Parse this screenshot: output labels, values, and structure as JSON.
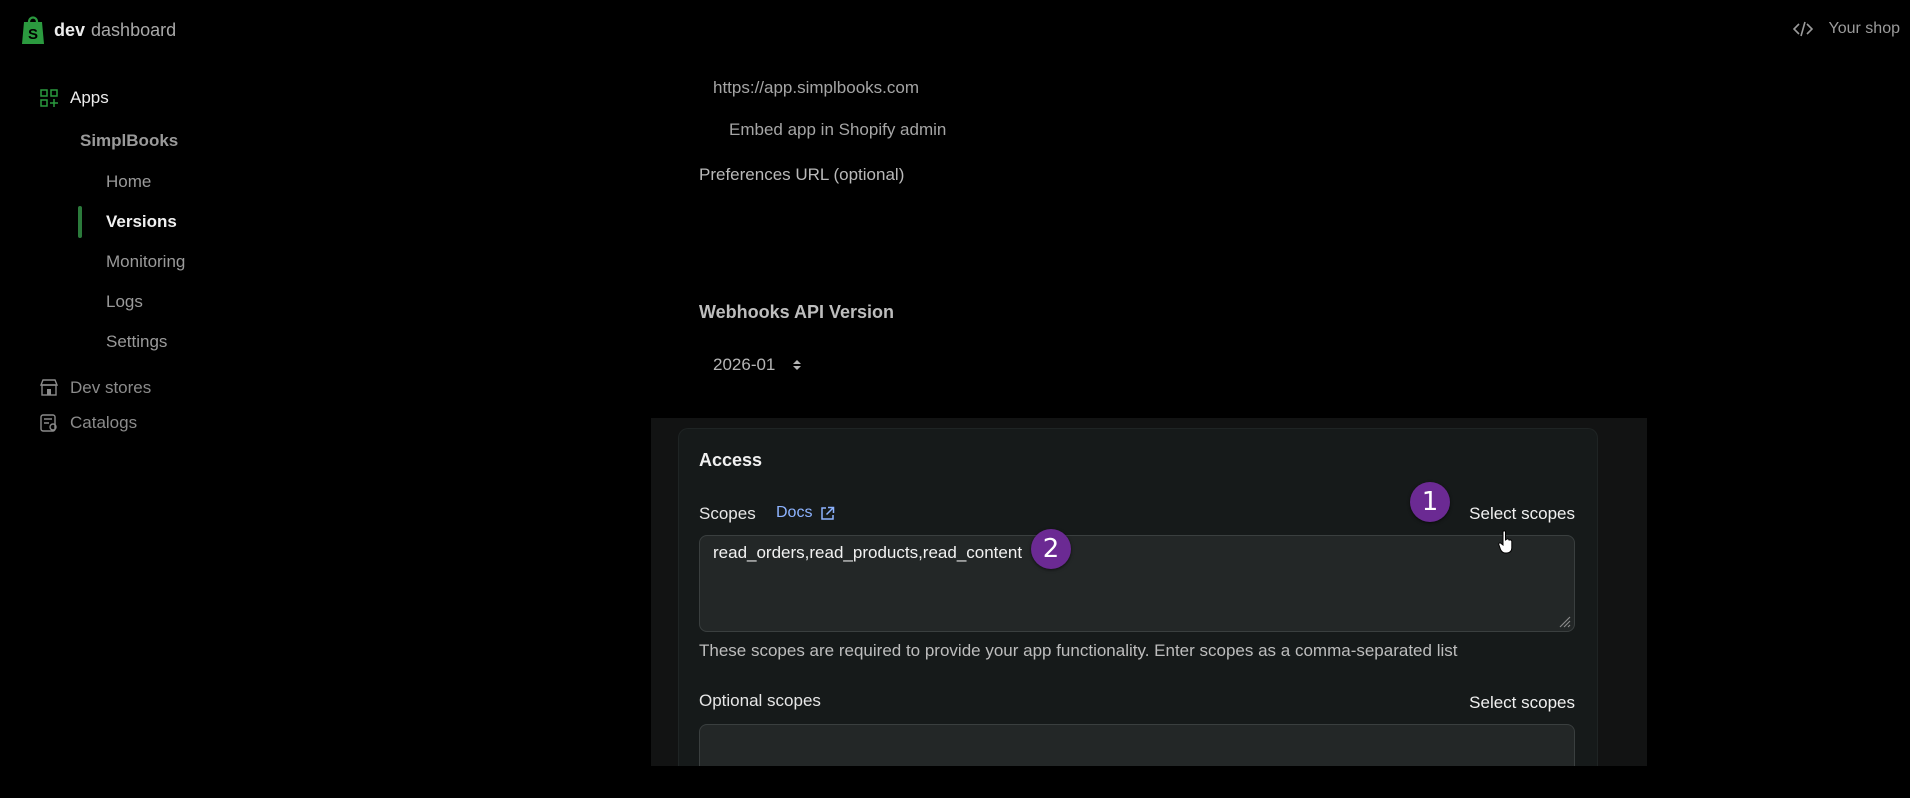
{
  "header": {
    "brand_strong": "dev",
    "brand_light": "dashboard",
    "shop_label": "Your shop",
    "brand_color": "#2b9a3f"
  },
  "sidebar": {
    "apps_label": "Apps",
    "app_name": "SimplBooks",
    "items": [
      {
        "label": "Home",
        "active": false
      },
      {
        "label": "Versions",
        "active": true
      },
      {
        "label": "Monitoring",
        "active": false
      },
      {
        "label": "Logs",
        "active": false
      },
      {
        "label": "Settings",
        "active": false
      }
    ],
    "dev_stores_label": "Dev stores",
    "catalogs_label": "Catalogs",
    "active_color": "#2b7a3b"
  },
  "main": {
    "app_url": "https://app.simplbooks.com",
    "embed_label": "Embed app in Shopify admin",
    "preferences_label": "Preferences URL (optional)",
    "webhooks_label": "Webhooks API Version",
    "webhooks_version": "2026-01"
  },
  "access": {
    "title": "Access",
    "scopes_label": "Scopes",
    "docs_label": "Docs",
    "select_scopes_label": "Select scopes",
    "scopes_value": "read_orders,read_products,read_content",
    "helper_text": "These scopes are required to provide your app functionality. Enter scopes as a comma-separated list",
    "optional_label": "Optional scopes",
    "optional_select_label": "Select scopes",
    "optional_value": ""
  },
  "markers": {
    "step1": "1",
    "step2": "2",
    "color": "#6b2a93"
  },
  "icons": {
    "logo": "shopify-bag-icon",
    "code": "code-icon",
    "apps": "apps-grid-icon",
    "dev_stores": "store-icon",
    "catalogs": "catalog-icon",
    "docs_external": "external-link-icon",
    "select_arrows": "up-down-chevron-icon",
    "cursor": "hand-pointer-icon"
  }
}
